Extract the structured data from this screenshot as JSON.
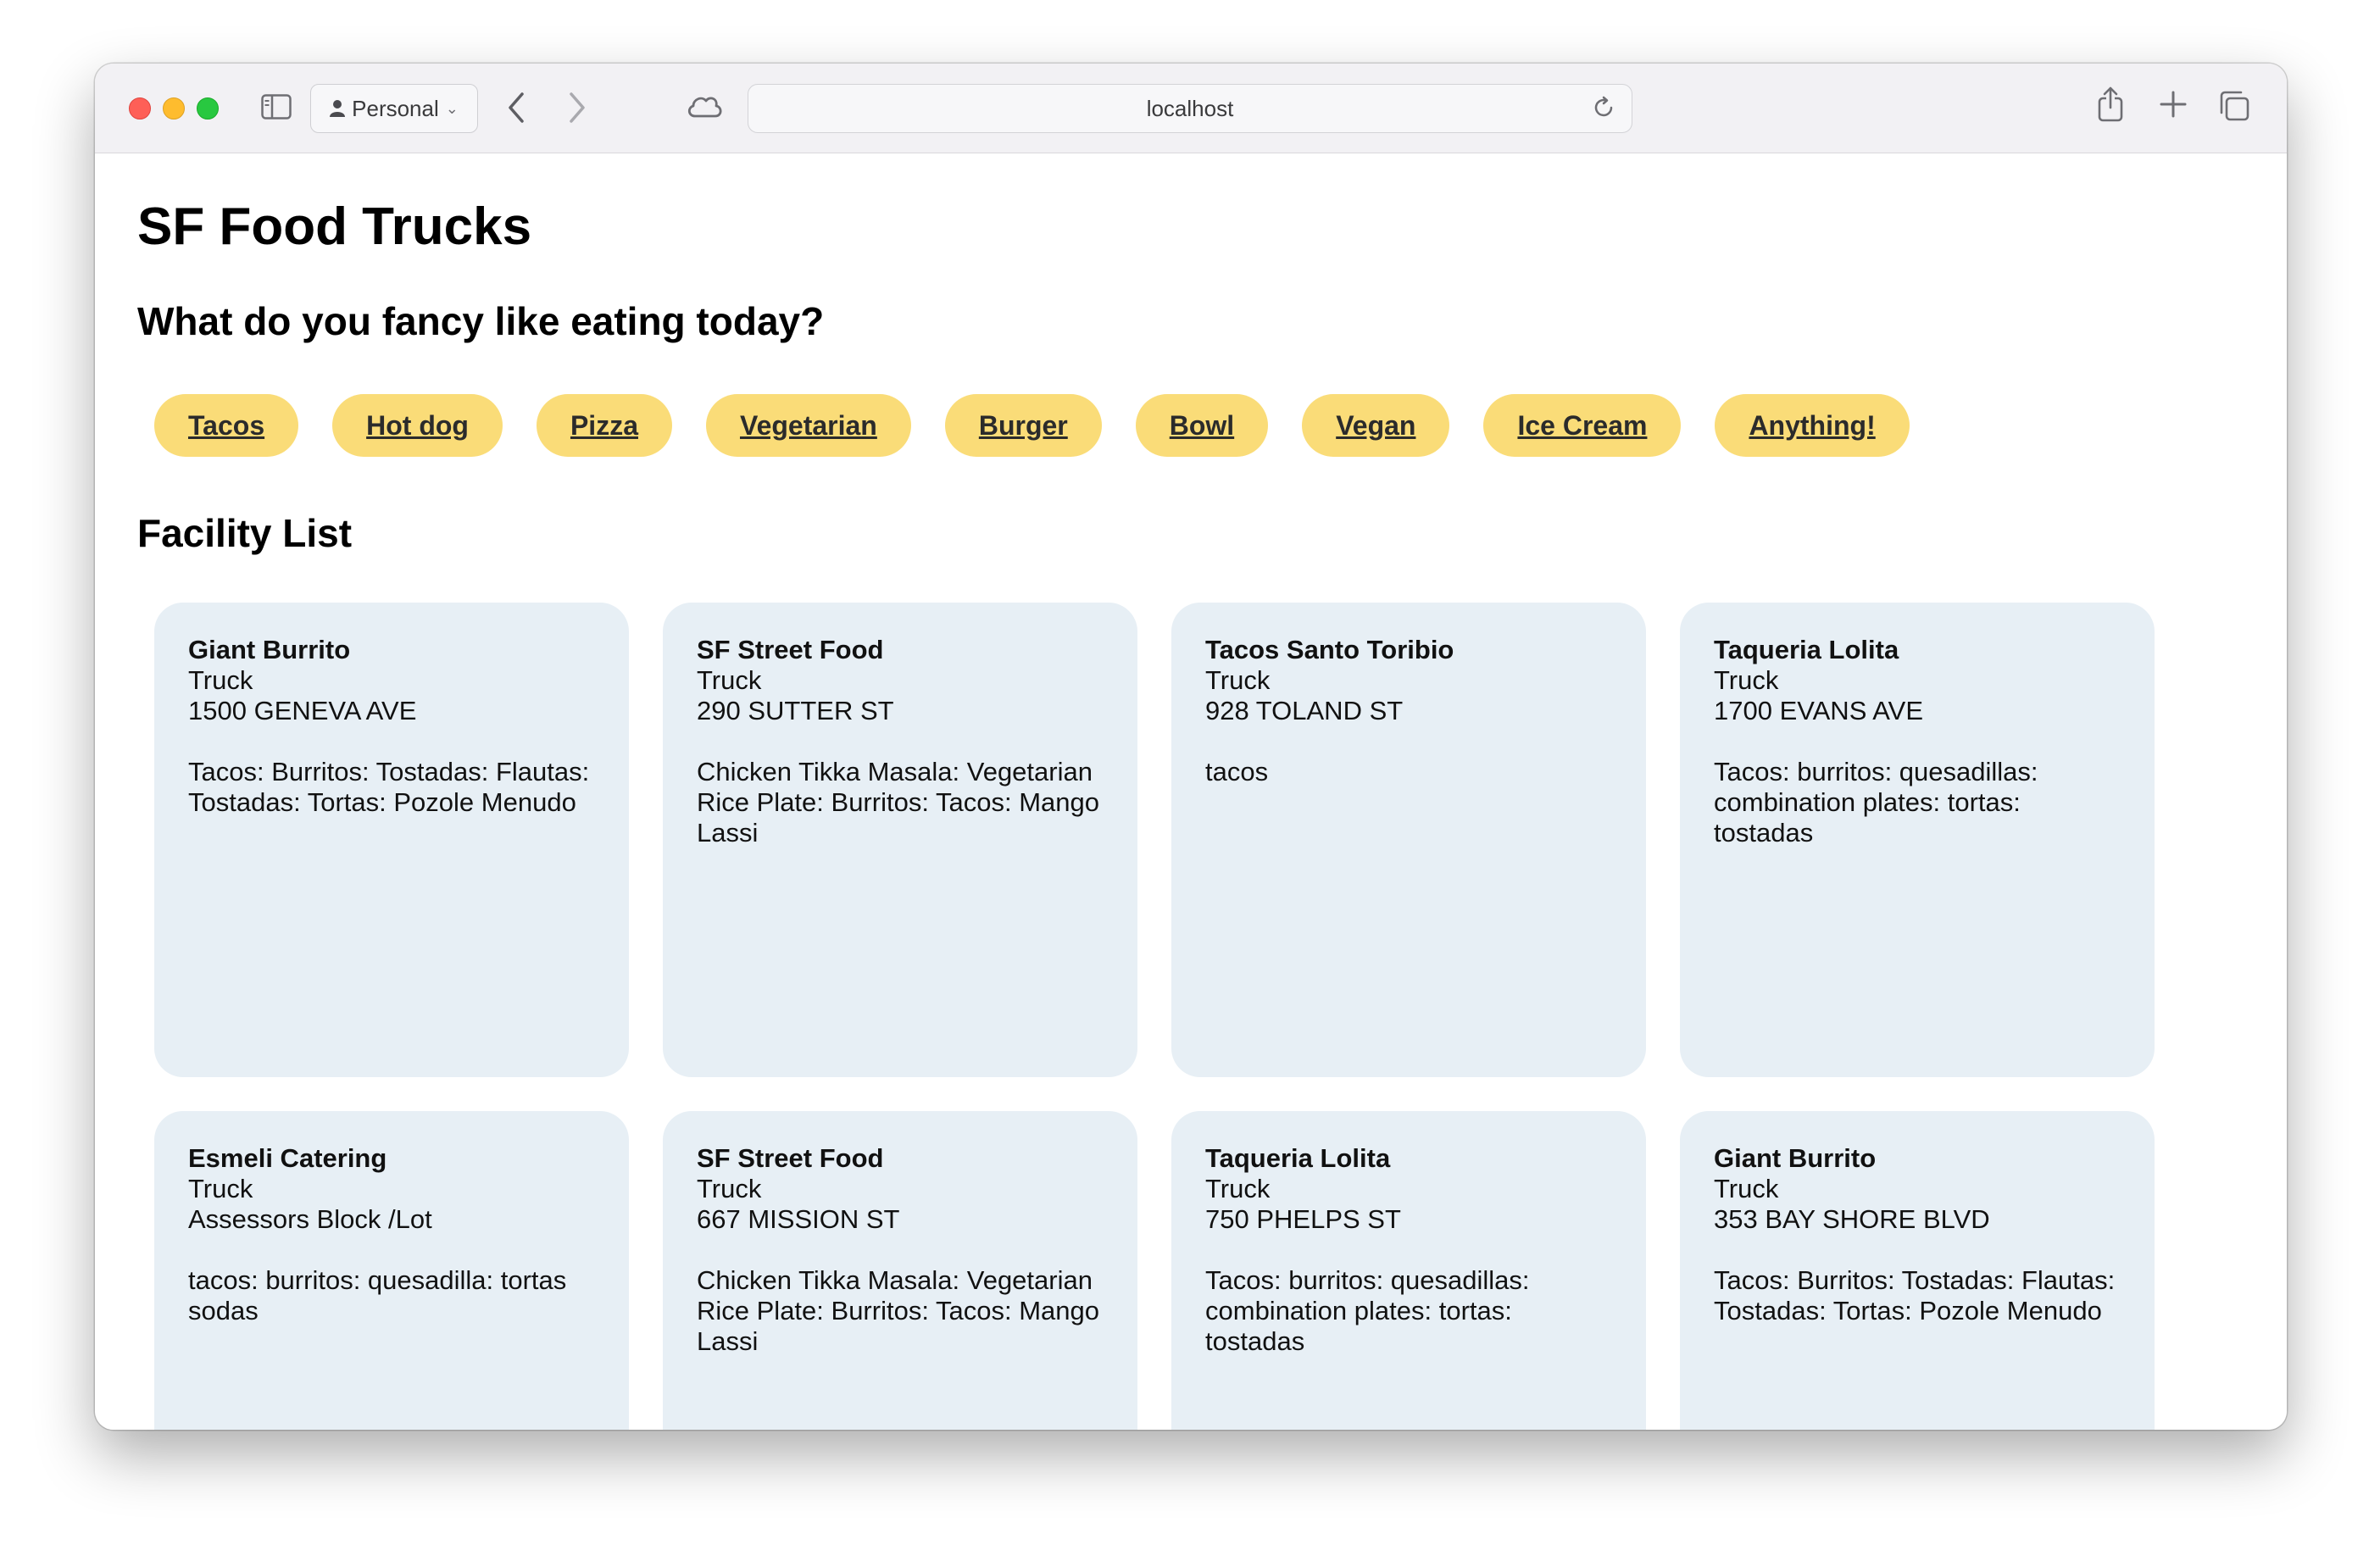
{
  "browser": {
    "profile_label": "Personal",
    "address": "localhost"
  },
  "page": {
    "title": "SF Food Trucks",
    "question": "What do you fancy like eating today?",
    "filters": [
      "Tacos",
      "Hot dog",
      "Pizza",
      "Vegetarian",
      "Burger",
      "Bowl",
      "Vegan",
      "Ice Cream",
      "Anything!"
    ],
    "facility_heading": "Facility List",
    "facilities": [
      {
        "name": "Giant Burrito",
        "type": "Truck",
        "address": "1500 GENEVA AVE",
        "items": "Tacos: Burritos: Tostadas: Flautas: Tostadas: Tortas: Pozole Menudo"
      },
      {
        "name": "SF Street Food",
        "type": "Truck",
        "address": "290 SUTTER ST",
        "items": "Chicken Tikka Masala: Vegetarian Rice Plate: Burritos: Tacos: Mango Lassi"
      },
      {
        "name": "Tacos Santo Toribio",
        "type": "Truck",
        "address": "928 TOLAND ST",
        "items": "tacos"
      },
      {
        "name": "Taqueria Lolita",
        "type": "Truck",
        "address": "1700 EVANS AVE",
        "items": "Tacos: burritos: quesadillas: combination plates: tortas: tostadas"
      },
      {
        "name": "Esmeli Catering",
        "type": "Truck",
        "address": "Assessors Block /Lot",
        "items": "tacos: burritos: quesadilla: tortas sodas"
      },
      {
        "name": "SF Street Food",
        "type": "Truck",
        "address": "667 MISSION ST",
        "items": "Chicken Tikka Masala: Vegetarian Rice Plate: Burritos: Tacos: Mango Lassi"
      },
      {
        "name": "Taqueria Lolita",
        "type": "Truck",
        "address": "750 PHELPS ST",
        "items": "Tacos: burritos: quesadillas: combination plates: tortas: tostadas"
      },
      {
        "name": "Giant Burrito",
        "type": "Truck",
        "address": "353 BAY SHORE BLVD",
        "items": "Tacos: Burritos: Tostadas: Flautas: Tostadas: Tortas: Pozole Menudo"
      }
    ]
  },
  "colors": {
    "chip_bg": "#fadc78",
    "card_bg": "#e7eff5",
    "toolbar_bg": "#f2f1f4"
  },
  "icons": [
    "sidebar-icon",
    "person-icon",
    "chevron-down-icon",
    "back-icon",
    "forward-icon",
    "cloud-icon",
    "reload-icon",
    "share-icon",
    "new-tab-icon",
    "tabs-overview-icon"
  ]
}
